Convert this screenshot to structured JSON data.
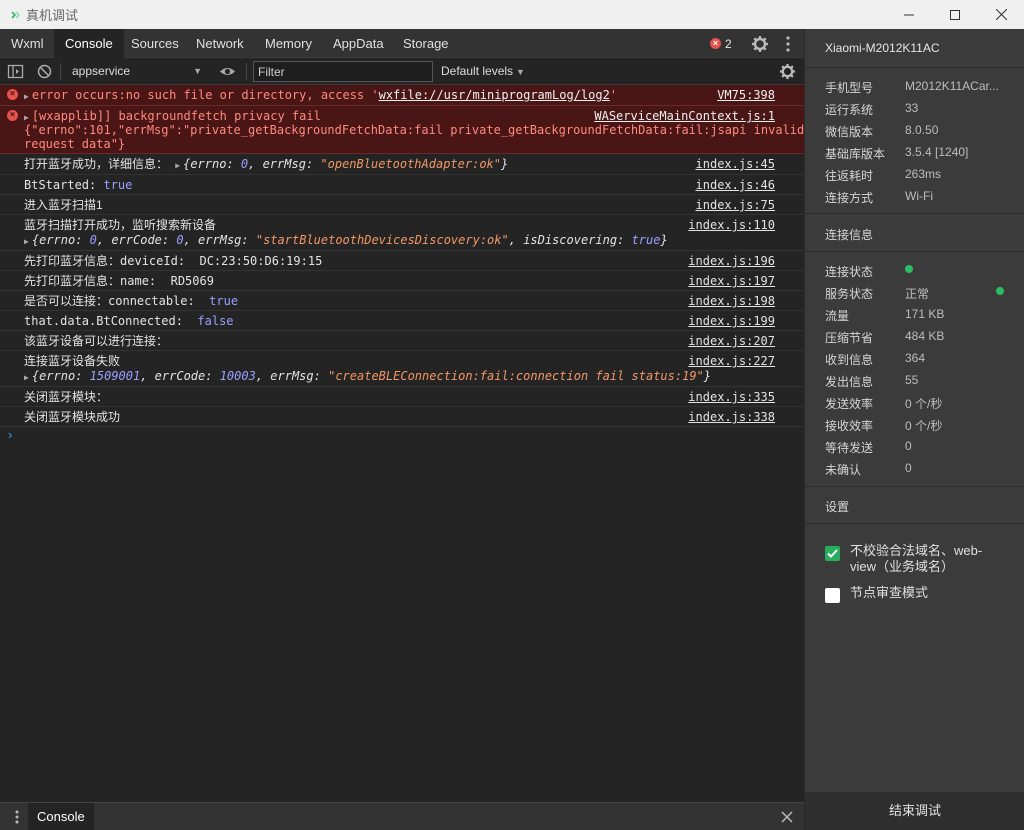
{
  "window": {
    "title": "真机调试"
  },
  "tabs": [
    "Wxml",
    "Console",
    "Sources",
    "Network",
    "Memory",
    "AppData",
    "Storage"
  ],
  "error_count": "2",
  "toolbar": {
    "context": "appservice",
    "filter_placeholder": "Filter",
    "levels": "Default levels"
  },
  "logs": {
    "e1": {
      "msg": "error occurs:no such file or directory, access '",
      "link": "wxfile://usr/miniprogramLog/log2",
      "tail": "'",
      "src": "VM75:398"
    },
    "e2": {
      "msg": "[wxapplib]] backgroundfetch privacy fail",
      "l2": "{\"errno\":101,\"errMsg\":\"private_getBackgroundFetchData:fail private_getBackgroundFetchData:fail:jsapi invalid",
      "l3": "request data\"}",
      "src": "WAServiceMainContext.js:1"
    },
    "r1": {
      "label": "打开蓝牙成功，详细信息：",
      "obj_open": "{",
      "k1": "errno",
      "v1": "0",
      "k2": "errMsg",
      "v2": "\"openBluetoothAdapter:ok\"",
      "obj_close": "}",
      "src": "index.js:45"
    },
    "r2": {
      "label": "BtStarted:",
      "val": "true",
      "src": "index.js:46"
    },
    "r3": {
      "label": "进入蓝牙扫描1",
      "src": "index.js:75"
    },
    "r4": {
      "label": "蓝牙扫描打开成功，监听搜索新设备",
      "k1": "errno",
      "v1": "0",
      "k2": "errCode",
      "v2": "0",
      "k3": "errMsg",
      "v3": "\"startBluetoothDevicesDiscovery:ok\"",
      "k4": "isDiscovering",
      "v4": "true",
      "src": "index.js:110"
    },
    "r5": {
      "label": "先打印蓝牙信息：",
      "rest": "deviceId:  DC:23:50:D6:19:15",
      "src": "index.js:196"
    },
    "r6": {
      "label": "先打印蓝牙信息：",
      "rest": "name:  RD5069",
      "src": "index.js:197"
    },
    "r7": {
      "label": "是否可以连接：",
      "rest": "connectable:",
      "val": "true",
      "src": "index.js:198"
    },
    "r8": {
      "label": "that.data.BtConnected:",
      "val": "false",
      "src": "index.js:199"
    },
    "r9": {
      "label": "该蓝牙设备可以进行连接：",
      "src": "index.js:207"
    },
    "r10": {
      "label": "连接蓝牙设备失败",
      "k1": "errno",
      "v1": "1509001",
      "k2": "errCode",
      "v2": "10003",
      "k3": "errMsg",
      "v3": "\"createBLEConnection:fail:connection fail status:19\"",
      "src": "index.js:227"
    },
    "r11": {
      "label": "关闭蓝牙模块：",
      "src": "index.js:335"
    },
    "r12": {
      "label": "关闭蓝牙模块成功",
      "src": "index.js:338"
    }
  },
  "drawer": {
    "tab": "Console"
  },
  "device": {
    "name": "Xiaomi-M2012K11AC",
    "info": [
      {
        "k": "手机型号",
        "v": "M2012K11ACar..."
      },
      {
        "k": "运行系统",
        "v": "33"
      },
      {
        "k": "微信版本",
        "v": "8.0.50"
      },
      {
        "k": "基础库版本",
        "v": "3.5.4 [1240]"
      },
      {
        "k": "往返耗时",
        "v": "263ms"
      },
      {
        "k": "连接方式",
        "v": "Wi-Fi"
      }
    ],
    "conn_title": "连接信息",
    "conn": [
      {
        "k": "连接状态",
        "v": ""
      },
      {
        "k": "服务状态",
        "v": "正常"
      },
      {
        "k": "流量",
        "v": "171 KB"
      },
      {
        "k": "压缩节省",
        "v": "484 KB"
      },
      {
        "k": "收到信息",
        "v": "364"
      },
      {
        "k": "发出信息",
        "v": "55"
      },
      {
        "k": "发送效率",
        "v": "0 个/秒"
      },
      {
        "k": "接收效率",
        "v": "0 个/秒"
      },
      {
        "k": "等待发送",
        "v": "0"
      },
      {
        "k": "未确认",
        "v": "0"
      }
    ],
    "settings_title": "设置",
    "opt1": "不校验合法域名、web-view（业务域名）",
    "opt2": "节点审查模式",
    "end_button": "结束调试",
    "status_color": "#2bbd63"
  }
}
